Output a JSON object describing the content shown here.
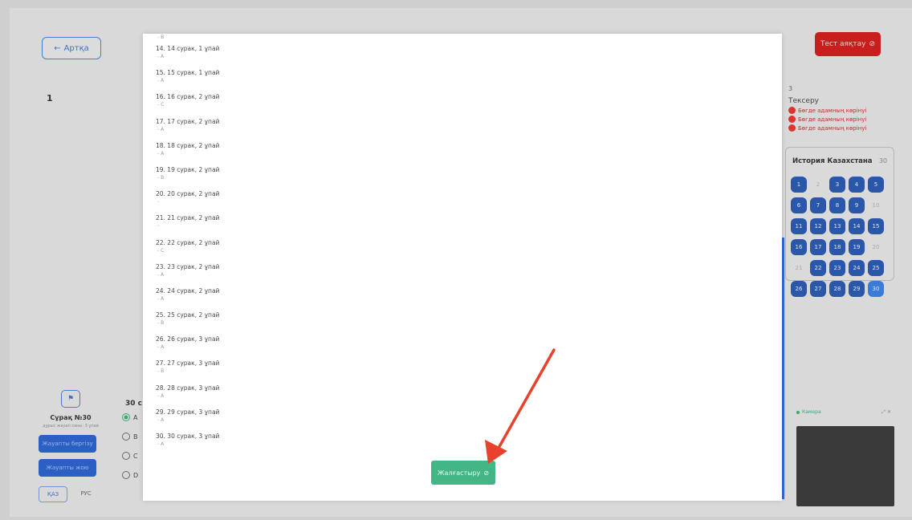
{
  "header": {
    "back_label": "Артқа",
    "finish_label": "Тест аяқтау",
    "finish_icon": "⊘"
  },
  "content_row_number": "1",
  "violations": {
    "count": "3",
    "heading": "Тексеру",
    "items": [
      "Бөгде адамның көрінуі",
      "Бөгде адамның көрінуі",
      "Бөгде адамның көрінуі"
    ]
  },
  "subject_panel": {
    "title": "История Казахстана",
    "count": "30",
    "numbers": [
      "1",
      "2",
      "3",
      "4",
      "5",
      "6",
      "7",
      "8",
      "9",
      "10",
      "11",
      "12",
      "13",
      "14",
      "15",
      "16",
      "17",
      "18",
      "19",
      "20",
      "21",
      "22",
      "23",
      "24",
      "25",
      "26",
      "27",
      "28",
      "29",
      "30"
    ],
    "unanswered": [
      "2",
      "10",
      "20",
      "21"
    ]
  },
  "question_sidebar": {
    "title": "Сұрақ №30",
    "subtitle": "дұрыс жауап саны: 3 ұпай",
    "prev_label": "Жауапты бергізу",
    "next_label": "Жауапты жою",
    "lang_kaz": "ҚАЗ",
    "lang_rus": "РУС"
  },
  "question_area": {
    "heading": "30 с",
    "options": [
      "A",
      "B",
      "C",
      "D"
    ],
    "selected": "A"
  },
  "camera": {
    "label": "Камера",
    "status_color": "#3aa870"
  },
  "modal": {
    "answers": [
      {
        "q": "",
        "a": "- B"
      },
      {
        "q": "14. 14 сурак, 1 ұпай",
        "a": "- A"
      },
      {
        "q": "15. 15 сурак, 1 ұпай",
        "a": "- A"
      },
      {
        "q": "16. 16 сурак, 2 ұпай",
        "a": "- C"
      },
      {
        "q": "17. 17 сурак, 2 ұпай",
        "a": "- A"
      },
      {
        "q": "18. 18 сурак, 2 ұпай",
        "a": "- A"
      },
      {
        "q": "19. 19 сурак, 2 ұпай",
        "a": "- B"
      },
      {
        "q": "20. 20 сурак, 2 ұпай",
        "a": "-"
      },
      {
        "q": "21. 21 сурак, 2 ұпай",
        "a": "-"
      },
      {
        "q": "22. 22 сурак, 2 ұпай",
        "a": "- C"
      },
      {
        "q": "23. 23 сурак, 2 ұпай",
        "a": "- A"
      },
      {
        "q": "24. 24 сурак, 2 ұпай",
        "a": "- A"
      },
      {
        "q": "25. 25 сурак, 2 ұпай",
        "a": "- B"
      },
      {
        "q": "26. 26 сурак, 3 ұпай",
        "a": "- A"
      },
      {
        "q": "27. 27 сурак, 3 ұпай",
        "a": "- B"
      },
      {
        "q": "28. 28 сурак, 3 ұпай",
        "a": "- A"
      },
      {
        "q": "29. 29 сурак, 3 ұпай",
        "a": "- A"
      },
      {
        "q": "30. 30 сурак, 3 ұпай",
        "a": "- A"
      }
    ],
    "submit_label": "Жалғастыру",
    "submit_icon": "⊘"
  },
  "colors": {
    "accent_red": "#c81e1e",
    "accent_green": "#44b584",
    "accent_blue": "#2b57a8",
    "arrow": "#e8412c"
  }
}
